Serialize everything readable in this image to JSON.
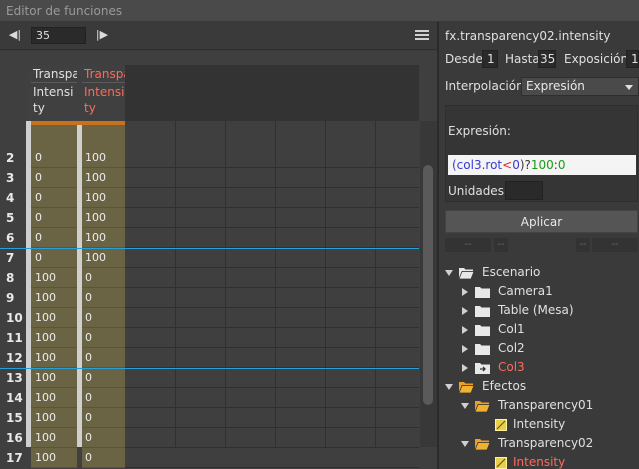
{
  "window": {
    "title": "Editor de funciones"
  },
  "toolbar": {
    "prev_icon": "◀|",
    "frame_value": "35",
    "next_icon": "|▶"
  },
  "sheet": {
    "columns": [
      {
        "line1": "Transpa",
        "line2": "Intensity",
        "color": "#e0e0e0"
      },
      {
        "line1": "Transpa",
        "line2": "Intensity",
        "color": "#ff6a5a"
      }
    ],
    "rows": [
      {
        "num": "2",
        "c1": "0",
        "c2": "100"
      },
      {
        "num": "3",
        "c1": "0",
        "c2": "100"
      },
      {
        "num": "4",
        "c1": "0",
        "c2": "100"
      },
      {
        "num": "5",
        "c1": "0",
        "c2": "100"
      },
      {
        "num": "6",
        "c1": "0",
        "c2": "100"
      },
      {
        "num": "7",
        "c1": "0",
        "c2": "100"
      },
      {
        "num": "8",
        "c1": "100",
        "c2": "0"
      },
      {
        "num": "9",
        "c1": "100",
        "c2": "0"
      },
      {
        "num": "10",
        "c1": "100",
        "c2": "0"
      },
      {
        "num": "11",
        "c1": "100",
        "c2": "0"
      },
      {
        "num": "12",
        "c1": "100",
        "c2": "0"
      },
      {
        "num": "13",
        "c1": "100",
        "c2": "0"
      },
      {
        "num": "14",
        "c1": "100",
        "c2": "0"
      },
      {
        "num": "15",
        "c1": "100",
        "c2": "0"
      },
      {
        "num": "16",
        "c1": "100",
        "c2": "0"
      },
      {
        "num": "17",
        "c1": "100",
        "c2": "0"
      }
    ]
  },
  "inspector": {
    "title": "fx.transparency02.intensity",
    "from_label": "Desde",
    "from_value": "1",
    "to_label": "Hasta",
    "to_value": "35",
    "exposure_label": "Exposición",
    "exposure_value": "1",
    "interp_label": "Interpolación:",
    "interp_value": "Expresión",
    "expr_label": "Expresión:",
    "expr_parts": [
      {
        "t": "(col3.rot",
        "c": "#3a3ad0"
      },
      {
        "t": "<",
        "c": "#d03030"
      },
      {
        "t": "0",
        "c": "#3a3ad0"
      },
      {
        "t": ")?",
        "c": "#3a3a3a"
      },
      {
        "t": "100",
        "c": "#1a9a1a"
      },
      {
        "t": ":",
        "c": "#3a3a3a"
      },
      {
        "t": "0",
        "c": "#1a9a1a"
      }
    ],
    "units_label": "Unidades:",
    "apply_label": "Aplicar",
    "dash": "--"
  },
  "tree": [
    {
      "label": "Escenario",
      "indent": 0,
      "arrow": "down",
      "icon": "folder-open",
      "red": false
    },
    {
      "label": "Camera1",
      "indent": 1,
      "arrow": "right",
      "icon": "folder",
      "red": false
    },
    {
      "label": "Table (Mesa)",
      "indent": 1,
      "arrow": "right",
      "icon": "folder",
      "red": false
    },
    {
      "label": "Col1",
      "indent": 1,
      "arrow": "right",
      "icon": "folder",
      "red": false
    },
    {
      "label": "Col2",
      "indent": 1,
      "arrow": "right",
      "icon": "folder",
      "red": false
    },
    {
      "label": "Col3",
      "indent": 1,
      "arrow": "right",
      "icon": "folder-link",
      "red": true
    },
    {
      "label": "Efectos",
      "indent": 0,
      "arrow": "down",
      "icon": "folder-orange",
      "red": false
    },
    {
      "label": "Transparency01",
      "indent": 1,
      "arrow": "down",
      "icon": "folder-orange",
      "red": false
    },
    {
      "label": "Intensity",
      "indent": 2,
      "arrow": "none",
      "icon": "fx",
      "red": false
    },
    {
      "label": "Transparency02",
      "indent": 1,
      "arrow": "down",
      "icon": "folder-orange",
      "red": false
    },
    {
      "label": "Intensity",
      "indent": 2,
      "arrow": "none",
      "icon": "fx",
      "red": true
    }
  ]
}
